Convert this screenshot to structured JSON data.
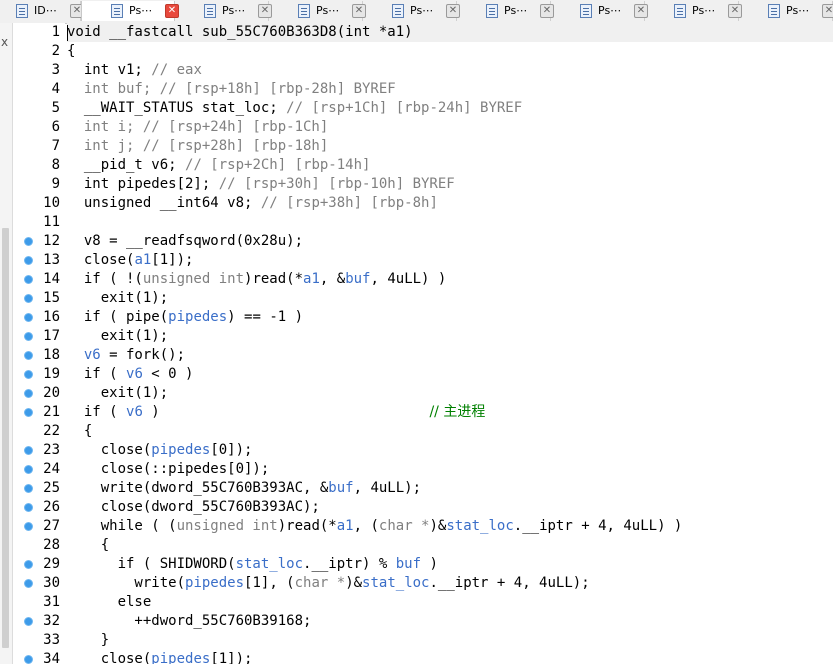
{
  "tabs": [
    {
      "label": "ID⋯",
      "active": false
    },
    {
      "label": "Ps⋯",
      "active": true
    },
    {
      "label": "Ps⋯",
      "active": false
    },
    {
      "label": "Ps⋯",
      "active": false
    },
    {
      "label": "Ps⋯",
      "active": false
    },
    {
      "label": "Ps⋯",
      "active": false
    },
    {
      "label": "Ps⋯",
      "active": false
    },
    {
      "label": "Ps⋯",
      "active": false
    },
    {
      "label": "Ps⋯",
      "active": false
    }
  ],
  "tab_close_glyph": "✕",
  "left_strip_mark": "x",
  "colors": {
    "comment": "#008000",
    "dim": "#808080",
    "variable": "#3a6ec8",
    "breakpoint": "#3d9be9",
    "active_tab_close": "#e8493d"
  },
  "code_lines": [
    {
      "n": "1",
      "dot": false,
      "segs": [
        [
          "void",
          "cn"
        ],
        [
          " __fastcall sub_55C760B363D8(int *a1)",
          "cn"
        ]
      ]
    },
    {
      "n": "2",
      "dot": false,
      "segs": [
        [
          "{",
          "cn"
        ]
      ]
    },
    {
      "n": "3",
      "dot": false,
      "segs": [
        [
          "  int v1; ",
          "cn"
        ],
        [
          "// eax",
          "dim"
        ]
      ]
    },
    {
      "n": "4",
      "dot": false,
      "segs": [
        [
          "  int buf; ",
          "dim"
        ],
        [
          "// [rsp+18h] [rbp-28h] BYREF",
          "dim"
        ]
      ]
    },
    {
      "n": "5",
      "dot": false,
      "segs": [
        [
          "  __WAIT_STATUS stat_loc; ",
          "cn"
        ],
        [
          "// [rsp+1Ch] [rbp-24h] BYREF",
          "dim"
        ]
      ]
    },
    {
      "n": "6",
      "dot": false,
      "segs": [
        [
          "  int i; ",
          "dim"
        ],
        [
          "// [rsp+24h] [rbp-1Ch]",
          "dim"
        ]
      ]
    },
    {
      "n": "7",
      "dot": false,
      "segs": [
        [
          "  int j; ",
          "dim"
        ],
        [
          "// [rsp+28h] [rbp-18h]",
          "dim"
        ]
      ]
    },
    {
      "n": "8",
      "dot": false,
      "segs": [
        [
          "  __pid_t v6; ",
          "cn"
        ],
        [
          "// [rsp+2Ch] [rbp-14h]",
          "dim"
        ]
      ]
    },
    {
      "n": "9",
      "dot": false,
      "segs": [
        [
          "  int pipedes[2]; ",
          "cn"
        ],
        [
          "// [rsp+30h] [rbp-10h] BYREF",
          "dim"
        ]
      ]
    },
    {
      "n": "10",
      "dot": false,
      "segs": [
        [
          "  unsigned __int64 v8; ",
          "cn"
        ],
        [
          "// [rsp+38h] [rbp-8h]",
          "dim"
        ]
      ]
    },
    {
      "n": "11",
      "dot": false,
      "segs": [
        [
          "",
          "cn"
        ]
      ]
    },
    {
      "n": "12",
      "dot": true,
      "segs": [
        [
          "  v8 = __readfsqword(0x28u);",
          "cn"
        ]
      ]
    },
    {
      "n": "13",
      "dot": true,
      "segs": [
        [
          "  close(",
          "cn"
        ],
        [
          "a1",
          "var"
        ],
        [
          "[1]);",
          "cn"
        ]
      ]
    },
    {
      "n": "14",
      "dot": true,
      "segs": [
        [
          "  if ( !(",
          "cn"
        ],
        [
          "unsigned int",
          "dim"
        ],
        [
          ")read(*",
          "cn"
        ],
        [
          "a1",
          "var"
        ],
        [
          ", &",
          "cn"
        ],
        [
          "buf",
          "var"
        ],
        [
          ", 4uLL) )",
          "cn"
        ]
      ]
    },
    {
      "n": "15",
      "dot": true,
      "segs": [
        [
          "    exit(1);",
          "cn"
        ]
      ]
    },
    {
      "n": "16",
      "dot": true,
      "segs": [
        [
          "  if ( pipe(",
          "cn"
        ],
        [
          "pipedes",
          "var"
        ],
        [
          ") == -1 )",
          "cn"
        ]
      ]
    },
    {
      "n": "17",
      "dot": true,
      "segs": [
        [
          "    exit(1);",
          "cn"
        ]
      ]
    },
    {
      "n": "18",
      "dot": true,
      "segs": [
        [
          "  ",
          "cn"
        ],
        [
          "v6",
          "var"
        ],
        [
          " = fork();",
          "cn"
        ]
      ]
    },
    {
      "n": "19",
      "dot": true,
      "segs": [
        [
          "  if ( ",
          "cn"
        ],
        [
          "v6",
          "var"
        ],
        [
          " < 0 )",
          "cn"
        ]
      ]
    },
    {
      "n": "20",
      "dot": true,
      "segs": [
        [
          "    exit(1);",
          "cn"
        ]
      ]
    },
    {
      "n": "21",
      "dot": true,
      "segs": [
        [
          "  if ( ",
          "cn"
        ],
        [
          "v6",
          "var"
        ],
        [
          " )                                ",
          "cn"
        ],
        [
          "// 主进程",
          "cmt"
        ]
      ]
    },
    {
      "n": "22",
      "dot": false,
      "segs": [
        [
          "  {",
          "cn"
        ]
      ]
    },
    {
      "n": "23",
      "dot": true,
      "segs": [
        [
          "    close(",
          "cn"
        ],
        [
          "pipedes",
          "var"
        ],
        [
          "[0]);",
          "cn"
        ]
      ]
    },
    {
      "n": "24",
      "dot": true,
      "segs": [
        [
          "    close(::pipedes[0]);",
          "cn"
        ]
      ]
    },
    {
      "n": "25",
      "dot": true,
      "segs": [
        [
          "    write(dword_55C760B393AC, &",
          "cn"
        ],
        [
          "buf",
          "var"
        ],
        [
          ", 4uLL);",
          "cn"
        ]
      ]
    },
    {
      "n": "26",
      "dot": true,
      "segs": [
        [
          "    close(dword_55C760B393AC);",
          "cn"
        ]
      ]
    },
    {
      "n": "27",
      "dot": true,
      "segs": [
        [
          "    while ( (",
          "cn"
        ],
        [
          "unsigned int",
          "dim"
        ],
        [
          ")read(*",
          "cn"
        ],
        [
          "a1",
          "var"
        ],
        [
          ", (",
          "cn"
        ],
        [
          "char *",
          "dim"
        ],
        [
          ")&",
          "cn"
        ],
        [
          "stat_loc",
          "var"
        ],
        [
          ".__iptr + 4, 4uLL) )",
          "cn"
        ]
      ]
    },
    {
      "n": "28",
      "dot": false,
      "segs": [
        [
          "    {",
          "cn"
        ]
      ]
    },
    {
      "n": "29",
      "dot": true,
      "segs": [
        [
          "      if ( SHIDWORD(",
          "cn"
        ],
        [
          "stat_loc",
          "var"
        ],
        [
          ".__iptr) % ",
          "cn"
        ],
        [
          "buf",
          "var"
        ],
        [
          " )",
          "cn"
        ]
      ]
    },
    {
      "n": "30",
      "dot": true,
      "segs": [
        [
          "        write(",
          "cn"
        ],
        [
          "pipedes",
          "var"
        ],
        [
          "[1], (",
          "cn"
        ],
        [
          "char *",
          "dim"
        ],
        [
          ")&",
          "cn"
        ],
        [
          "stat_loc",
          "var"
        ],
        [
          ".__iptr + 4, 4uLL);",
          "cn"
        ]
      ]
    },
    {
      "n": "31",
      "dot": false,
      "segs": [
        [
          "      else",
          "cn"
        ]
      ]
    },
    {
      "n": "32",
      "dot": true,
      "segs": [
        [
          "        ++dword_55C760B39168;",
          "cn"
        ]
      ]
    },
    {
      "n": "33",
      "dot": false,
      "segs": [
        [
          "    }",
          "cn"
        ]
      ]
    },
    {
      "n": "34",
      "dot": true,
      "segs": [
        [
          "    close(",
          "cn"
        ],
        [
          "pipedes",
          "var"
        ],
        [
          "[1]);",
          "cn"
        ]
      ]
    }
  ]
}
